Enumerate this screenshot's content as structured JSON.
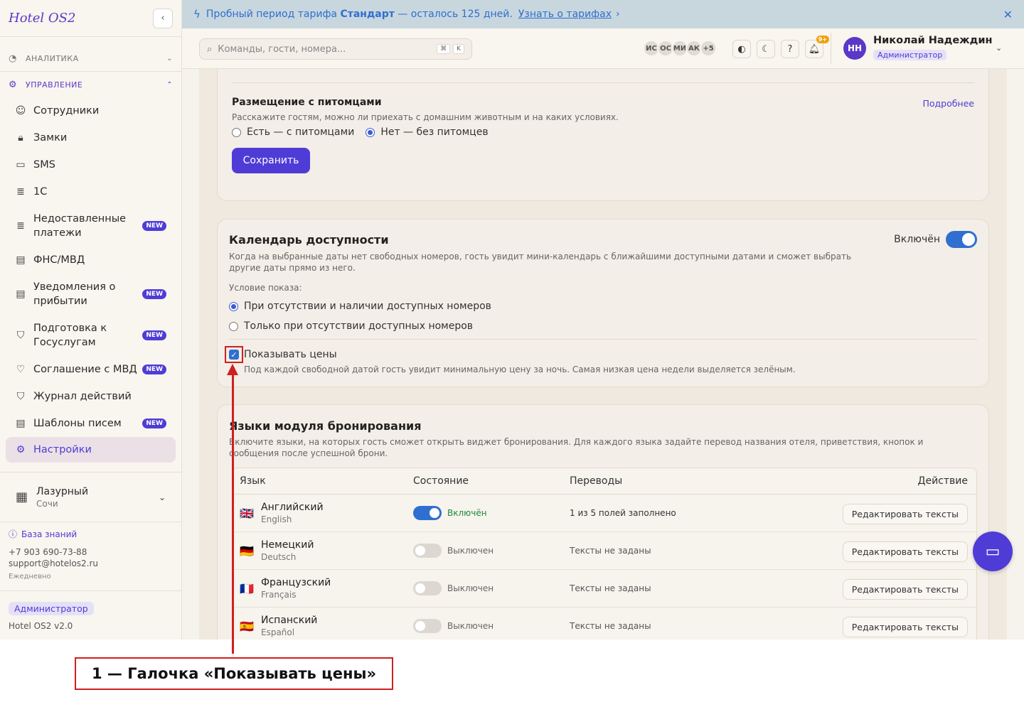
{
  "sidebar": {
    "logo": "Hotel OS2",
    "sections": [
      {
        "label": "АНАЛИТИКА",
        "icon": "chart-pie-icon"
      },
      {
        "label": "УПРАВЛЕНИЕ",
        "icon": "gear-icon"
      }
    ],
    "items": [
      {
        "label": "Сотрудники",
        "icon": "users-icon",
        "badge": ""
      },
      {
        "label": "Замки",
        "icon": "lock-icon",
        "badge": ""
      },
      {
        "label": "SMS",
        "icon": "message-icon",
        "badge": ""
      },
      {
        "label": "1С",
        "icon": "database-icon",
        "badge": ""
      },
      {
        "label": "Недоставленные платежи",
        "icon": "database-icon",
        "badge": "NEW"
      },
      {
        "label": "ФНС/МВД",
        "icon": "document-icon",
        "badge": ""
      },
      {
        "label": "Уведомления о прибытии",
        "icon": "document-icon",
        "badge": "NEW"
      },
      {
        "label": "Подготовка к Госуслугам",
        "icon": "shield-check-icon",
        "badge": "NEW"
      },
      {
        "label": "Соглашение с МВД",
        "icon": "handshake-icon",
        "badge": "NEW"
      },
      {
        "label": "Журнал действий",
        "icon": "shield-alert-icon",
        "badge": ""
      },
      {
        "label": "Шаблоны писем",
        "icon": "document-icon",
        "badge": "NEW"
      },
      {
        "label": "Настройки",
        "icon": "gear-icon",
        "badge": ""
      }
    ],
    "hotel": {
      "name": "Лазурный",
      "city": "Сочи"
    },
    "support": {
      "kb_label": "База знаний",
      "phone": "+7 903 690-73-88",
      "email": "support@hotelos2.ru",
      "hours": "Ежедневно"
    },
    "role": "Администратор",
    "version": "Hotel OS2 v2.0"
  },
  "promo": {
    "text_before": "Пробный период тарифа",
    "plan": "Стандарт",
    "text_after": "— осталось 125 дней.",
    "link": "Узнать о тарифах"
  },
  "header": {
    "search_placeholder": "Команды, гости, номера...",
    "kbd1": "⌘",
    "kbd2": "K",
    "avatars": [
      "ИС",
      "ОС",
      "МИ",
      "АК",
      "+5"
    ],
    "notif_count": "9+",
    "user_initials": "НН",
    "user_name": "Николай Надеждин",
    "user_role": "Администратор"
  },
  "pets": {
    "title": "Размещение с питомцами",
    "desc": "Расскажите гостям, можно ли приехать с домашним животным и на каких условиях.",
    "more": "Подробнее",
    "opt_yes": "Есть — с питомцами",
    "opt_no": "Нет — без питомцев",
    "save": "Сохранить"
  },
  "calendar": {
    "title": "Календарь доступности",
    "status": "Включён",
    "desc": "Когда на выбранные даты нет свободных номеров, гость увидит мини-календарь с ближайшими доступными датами и сможет выбрать другие даты прямо из него.",
    "condition_label": "Условие показа:",
    "opt1": "При отсутствии и наличии доступных номеров",
    "opt2": "Только при отсутствии доступных номеров",
    "show_prices": "Показывать цены",
    "show_prices_desc": "Под каждой свободной датой гость увидит минимальную цену за ночь. Самая низкая цена недели выделяется зелёным."
  },
  "languages": {
    "title": "Языки модуля бронирования",
    "desc": "Включите языки, на которых гость сможет открыть виджет бронирования. Для каждого языка задайте перевод названия отеля, приветствия, кнопок и сообщения после успешной брони.",
    "headers": [
      "Язык",
      "Состояние",
      "Переводы",
      "Действие"
    ],
    "rows": [
      {
        "flag": "🇬🇧",
        "name": "Английский",
        "native": "English",
        "state": "Включён",
        "enabled": true,
        "translations": "1 из 5 полей заполнено",
        "action": "Редактировать тексты"
      },
      {
        "flag": "🇩🇪",
        "name": "Немецкий",
        "native": "Deutsch",
        "state": "Выключен",
        "enabled": false,
        "translations": "Тексты не заданы",
        "action": "Редактировать тексты"
      },
      {
        "flag": "🇫🇷",
        "name": "Французский",
        "native": "Français",
        "state": "Выключен",
        "enabled": false,
        "translations": "Тексты не заданы",
        "action": "Редактировать тексты"
      },
      {
        "flag": "🇪🇸",
        "name": "Испанский",
        "native": "Español",
        "state": "Выключен",
        "enabled": false,
        "translations": "Тексты не заданы",
        "action": "Редактировать тексты"
      }
    ]
  },
  "annotation": {
    "label": "1 — Галочка «Показывать цены»"
  }
}
